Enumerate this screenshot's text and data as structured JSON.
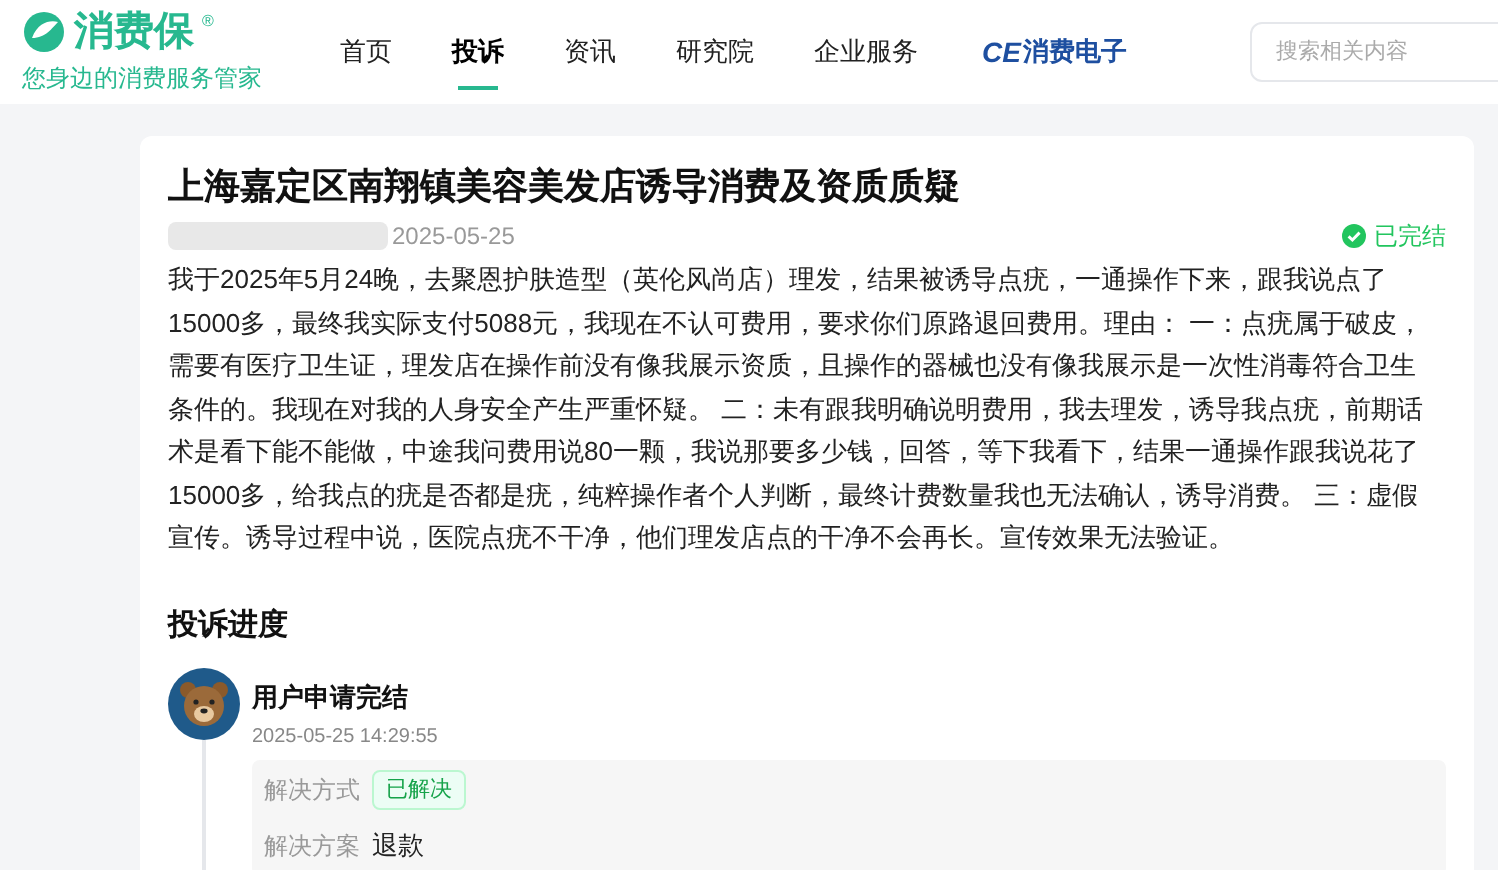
{
  "header": {
    "logo": {
      "name": "消费保",
      "mark": "®",
      "slogan": "您身边的消费服务管家"
    },
    "nav": [
      {
        "label": "首页",
        "selected": false
      },
      {
        "label": "投诉",
        "selected": true
      },
      {
        "label": "资讯",
        "selected": false
      },
      {
        "label": "研究院",
        "selected": false
      },
      {
        "label": "企业服务",
        "selected": false
      }
    ],
    "partner": {
      "prefix": "CE",
      "name": "消费电子"
    },
    "search": {
      "placeholder": "搜索相关内容"
    }
  },
  "complaint": {
    "title": "上海嘉定区南翔镇美容美发店诱导消费及资质质疑",
    "date": "2025-05-25",
    "status": "已完结",
    "body": "我于2025年5月24晚，去聚恩护肤造型（英伦风尚店）理发，结果被诱导点疣，一通操作下来，跟我说点了15000多，最终我实际支付5088元，我现在不认可费用，要求你们原路退回费用。理由： 一：点疣属于破皮，需要有医疗卫生证，理发店在操作前没有像我展示资质，且操作的器械也没有像我展示是一次性消毒符合卫生条件的。我现在对我的人身安全产生严重怀疑。 二：未有跟我明确说明费用，我去理发，诱导我点疣，前期话术是看下能不能做，中途我问费用说80一颗，我说那要多少钱，回答，等下我看下，结果一通操作跟我说花了15000多，给我点的疣是否都是疣，纯粹操作者个人判断，最终计费数量我也无法确认，诱导消费。 三：虚假宣传。诱导过程中说，医院点疣不干净，他们理发店点的干净不会再长。宣传效果无法验证。"
  },
  "progress": {
    "title": "投诉进度",
    "events": [
      {
        "title": "用户申请完结",
        "time": "2025-05-25 14:29:55",
        "fields": [
          {
            "label": "解决方式",
            "value": "已解决",
            "kind": "tag"
          },
          {
            "label": "解决方案",
            "value": "退款",
            "kind": "text"
          }
        ]
      }
    ]
  }
}
